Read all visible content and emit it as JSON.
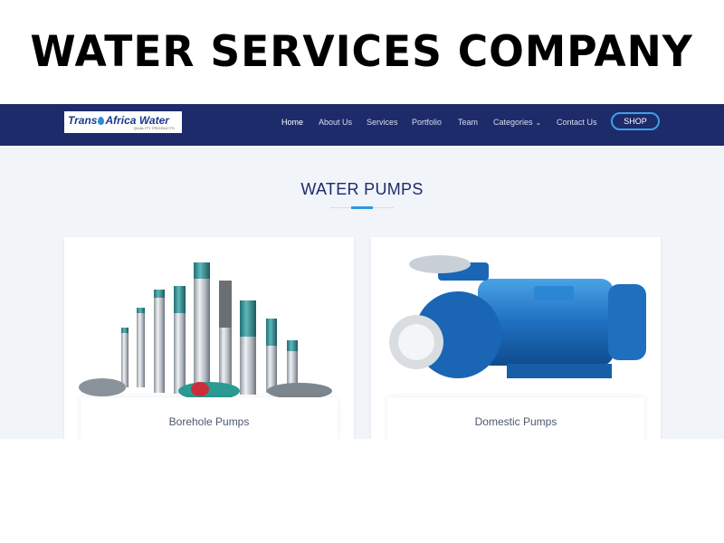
{
  "banner": {
    "title": "WATER SERVICES COMPANY"
  },
  "logo": {
    "text_trans": "Trans",
    "text_africa": "Africa Water",
    "tagline": "QUALITY PRODUCTS"
  },
  "nav": {
    "items": [
      "Home",
      "About Us",
      "Services",
      "Portfolio",
      "Team",
      "Categories",
      "Contact Us"
    ],
    "shop_label": "SHOP"
  },
  "section": {
    "title": "WATER PUMPS"
  },
  "cards": [
    {
      "caption": "Borehole Pumps"
    },
    {
      "caption": "Domestic Pumps"
    }
  ],
  "colors": {
    "nav_bg": "#1d2b6b",
    "accent": "#2a9be0",
    "section_bg": "#f1f4f9"
  }
}
